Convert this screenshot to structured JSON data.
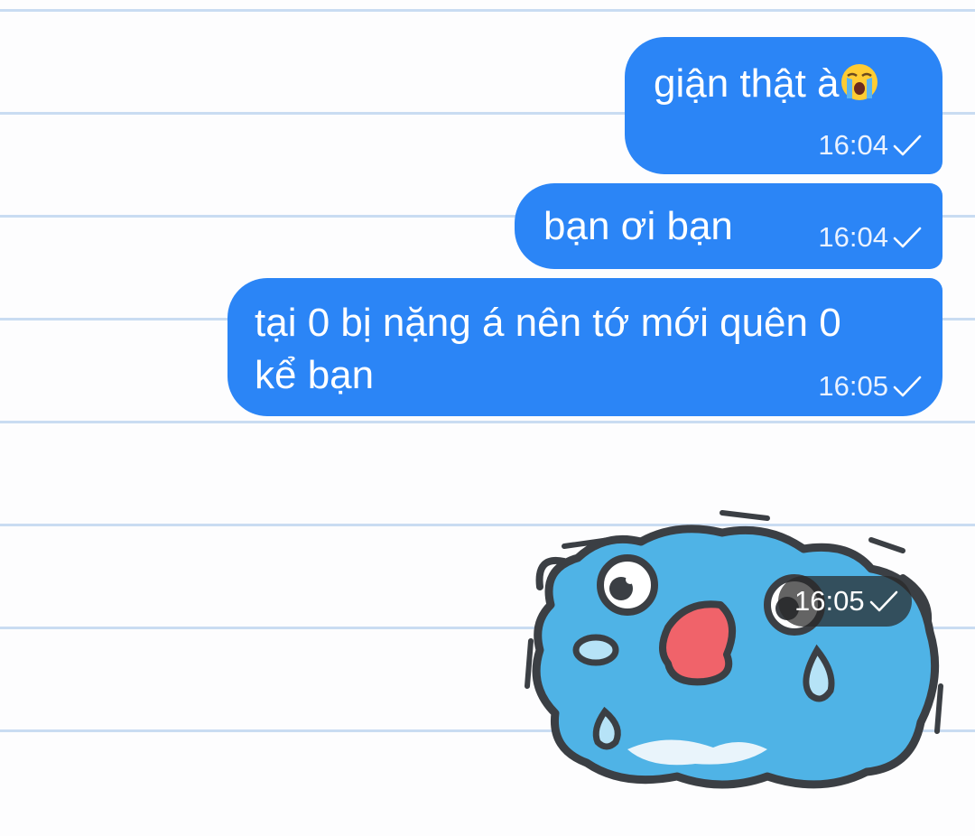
{
  "messages": [
    {
      "text": "giận thật à",
      "emoji": "loudly-crying-face",
      "time": "16:04",
      "status": "sent-check"
    },
    {
      "text": "bạn ơi bạn",
      "time": "16:04",
      "status": "sent-check"
    },
    {
      "text_line1": "tại 0 bị nặng á nên tớ mới quên 0",
      "text_line2": "kể bạn",
      "time": "16:05",
      "status": "sent-check"
    }
  ],
  "sticker": {
    "name": "crying-blue-cat-sticker",
    "time": "16:05",
    "status": "sent-check"
  },
  "colors": {
    "bubble": "#2b85f6",
    "background": "#fdfdfe",
    "ruled_line": "#c9dcf2",
    "sticker_body": "#4fb3e6",
    "sticker_mouth": "#f0636a"
  }
}
